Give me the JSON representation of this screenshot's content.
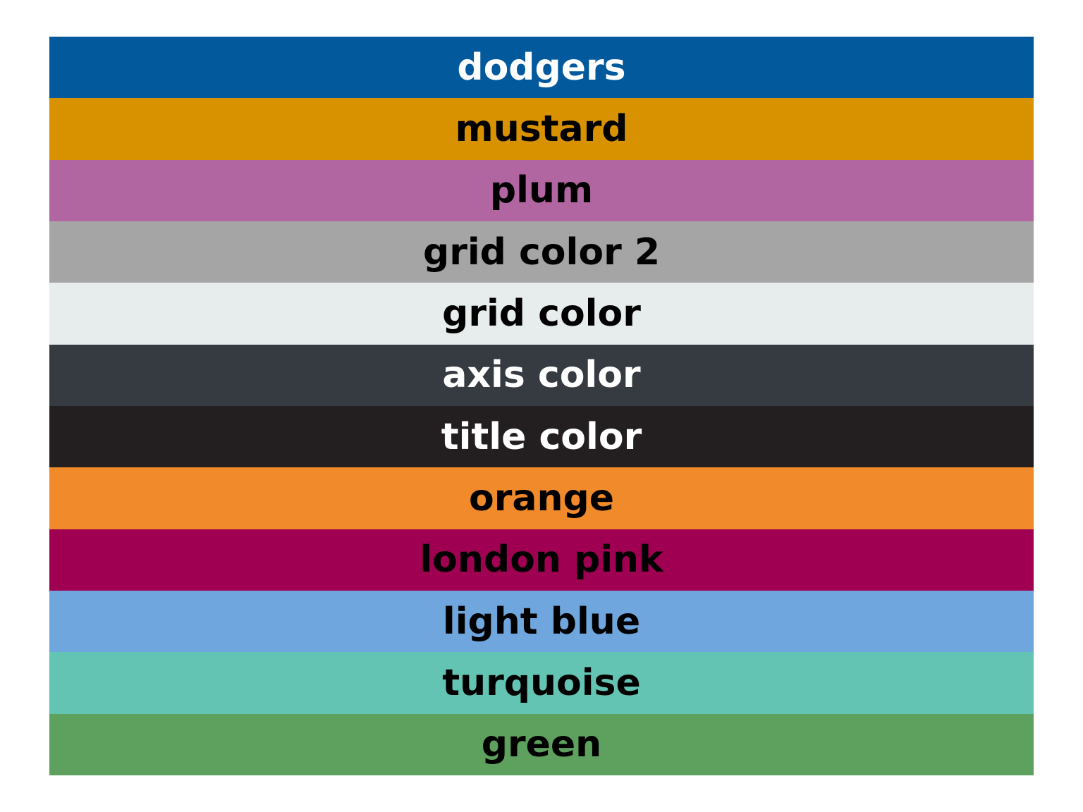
{
  "palette": {
    "swatches": [
      {
        "label": "dodgers",
        "color": "#02599c",
        "text_color": "#ffffff"
      },
      {
        "label": "mustard",
        "color": "#d89200",
        "text_color": "#000000"
      },
      {
        "label": "plum",
        "color": "#b166a2",
        "text_color": "#000000"
      },
      {
        "label": "grid color 2",
        "color": "#a5a5a5",
        "text_color": "#000000"
      },
      {
        "label": "grid color",
        "color": "#e7eced",
        "text_color": "#000000"
      },
      {
        "label": "axis color",
        "color": "#363b42",
        "text_color": "#ffffff"
      },
      {
        "label": "title color",
        "color": "#231f20",
        "text_color": "#ffffff"
      },
      {
        "label": "orange",
        "color": "#f08a2a",
        "text_color": "#000000"
      },
      {
        "label": "london pink",
        "color": "#9f0051",
        "text_color": "#000000"
      },
      {
        "label": "light blue",
        "color": "#6fa6dd",
        "text_color": "#000000"
      },
      {
        "label": "turquoise",
        "color": "#64c4b4",
        "text_color": "#000000"
      },
      {
        "label": "green",
        "color": "#5ea05d",
        "text_color": "#000000"
      }
    ]
  }
}
